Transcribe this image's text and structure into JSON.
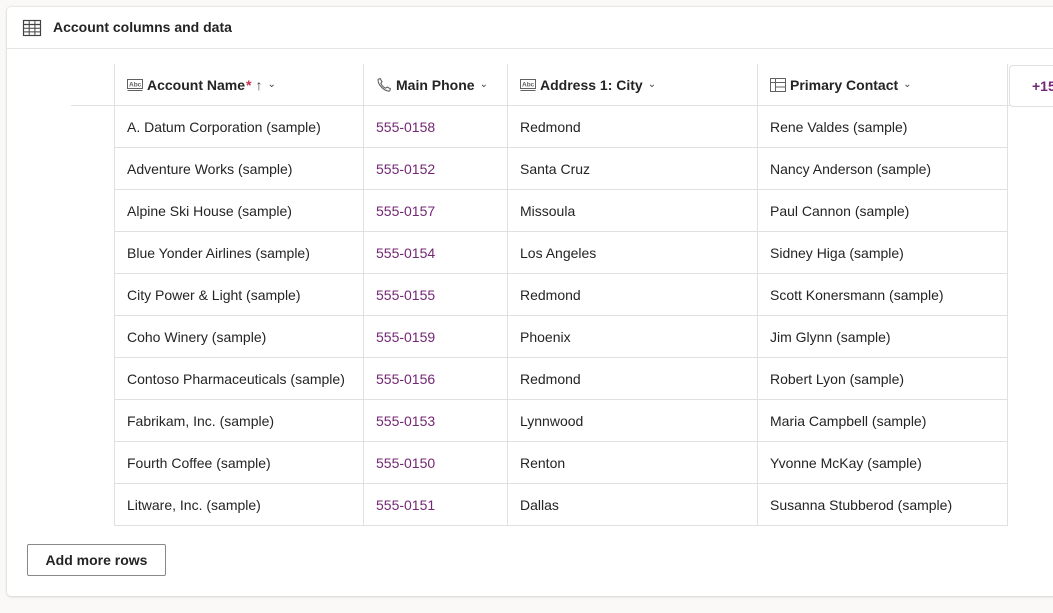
{
  "panel": {
    "title": "Account columns and data",
    "title_icon": "table-icon"
  },
  "columns": [
    {
      "label": "Account Name",
      "required_mark": "*",
      "sort_indicator": "↑",
      "icon": "text-field-icon",
      "menu_icon": "chevron-down-icon"
    },
    {
      "label": "Main Phone",
      "icon": "phone-icon",
      "menu_icon": "chevron-down-icon"
    },
    {
      "label": "Address 1: City",
      "icon": "text-field-icon",
      "menu_icon": "chevron-down-icon"
    },
    {
      "label": "Primary Contact",
      "icon": "lookup-icon",
      "menu_icon": "chevron-down-icon"
    }
  ],
  "more_columns_label": "+15",
  "rows": [
    {
      "name": "A. Datum Corporation (sample)",
      "phone": "555-0158",
      "city": "Redmond",
      "contact": "Rene Valdes (sample)"
    },
    {
      "name": "Adventure Works (sample)",
      "phone": "555-0152",
      "city": "Santa Cruz",
      "contact": "Nancy Anderson (sample)"
    },
    {
      "name": "Alpine Ski House (sample)",
      "phone": "555-0157",
      "city": "Missoula",
      "contact": "Paul Cannon (sample)"
    },
    {
      "name": "Blue Yonder Airlines (sample)",
      "phone": "555-0154",
      "city": "Los Angeles",
      "contact": "Sidney Higa (sample)"
    },
    {
      "name": "City Power & Light (sample)",
      "phone": "555-0155",
      "city": "Redmond",
      "contact": "Scott Konersmann (sample)"
    },
    {
      "name": "Coho Winery (sample)",
      "phone": "555-0159",
      "city": "Phoenix",
      "contact": "Jim Glynn (sample)"
    },
    {
      "name": "Contoso Pharmaceuticals (sample)",
      "phone": "555-0156",
      "city": "Redmond",
      "contact": "Robert Lyon (sample)"
    },
    {
      "name": "Fabrikam, Inc. (sample)",
      "phone": "555-0153",
      "city": "Lynnwood",
      "contact": "Maria Campbell (sample)"
    },
    {
      "name": "Fourth Coffee (sample)",
      "phone": "555-0150",
      "city": "Renton",
      "contact": "Yvonne McKay (sample)"
    },
    {
      "name": "Litware, Inc. (sample)",
      "phone": "555-0151",
      "city": "Dallas",
      "contact": "Susanna Stubberod (sample)"
    }
  ],
  "add_rows_label": "Add more rows",
  "colors": {
    "phone_link": "#742774",
    "required": "#c4314b",
    "border": "#e0e0e0"
  }
}
